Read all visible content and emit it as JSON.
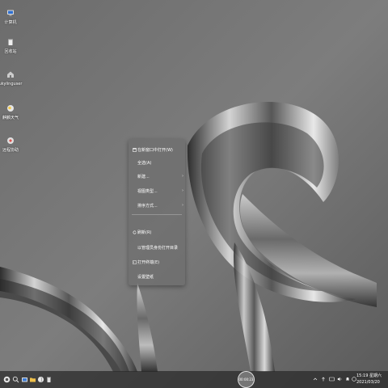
{
  "desktop": {
    "icons": [
      {
        "label": "计算机",
        "icon": "computer-icon"
      },
      {
        "label": "回收站",
        "icon": "trash-icon"
      },
      {
        "label": "ukylinguser",
        "icon": "home-folder-icon"
      },
      {
        "label": "麒麟天气",
        "icon": "weather-icon"
      },
      {
        "label": "远程协助",
        "icon": "remote-assist-icon"
      }
    ]
  },
  "context_menu": {
    "items": [
      {
        "label": "在新窗口中打开(W)",
        "icon": "window-icon",
        "submenu": false
      },
      {
        "label": "全选(A)",
        "icon": "",
        "submenu": false
      },
      {
        "label": "新建...",
        "icon": "",
        "submenu": true
      },
      {
        "label": "视图类型...",
        "icon": "",
        "submenu": true
      },
      {
        "label": "排序方式...",
        "icon": "",
        "submenu": true
      },
      {
        "label": "刷新(R)",
        "icon": "refresh-icon",
        "submenu": false
      },
      {
        "label": "以管理员身份打开目录",
        "icon": "",
        "submenu": false
      },
      {
        "label": "打开终端(E)",
        "icon": "terminal-icon",
        "submenu": false
      },
      {
        "label": "设置壁纸",
        "icon": "",
        "submenu": false
      }
    ],
    "submenu_arrow": "›"
  },
  "taskbar": {
    "left_icons": [
      "start-menu-icon",
      "search-icon",
      "file-manager-icon",
      "folder-icon",
      "browser-icon",
      "trash-icon"
    ],
    "center_label": "00:00:23",
    "tray_icons": [
      "chevron-up-icon",
      "network-icon",
      "keyboard-icon",
      "volume-icon",
      "notification-icon",
      "input-method-icon"
    ],
    "clock": {
      "time": "15:19 星期六",
      "date": "2021/03/20"
    }
  }
}
